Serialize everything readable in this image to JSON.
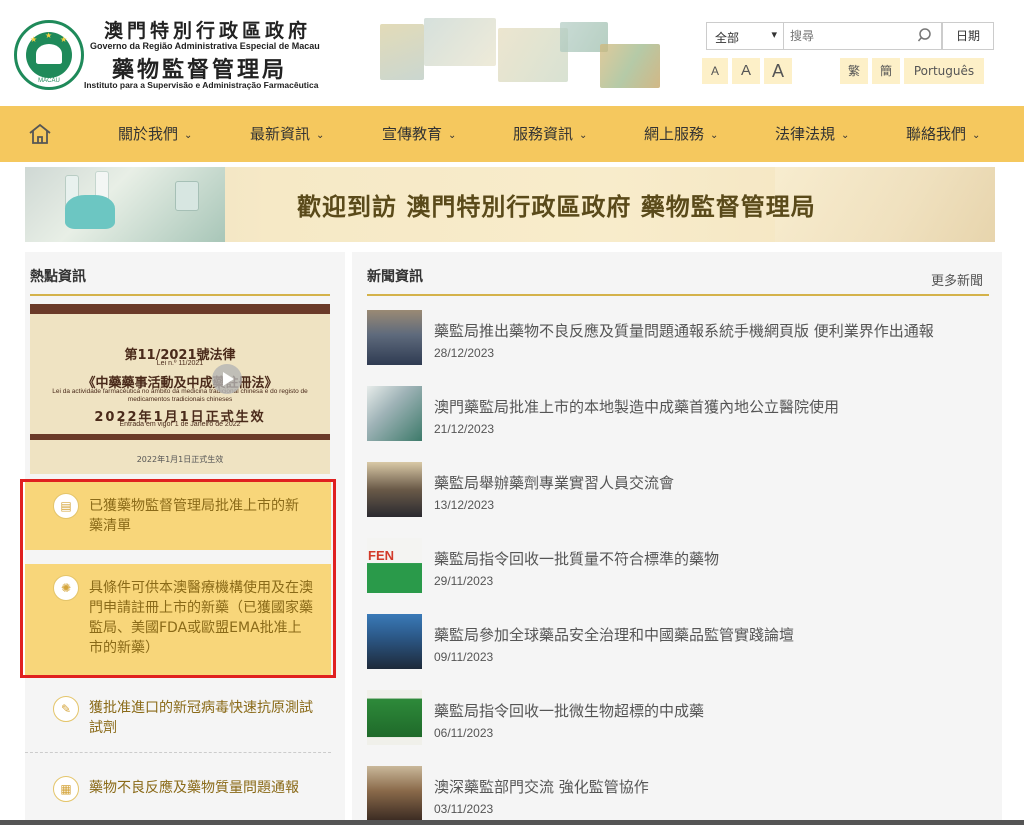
{
  "header": {
    "gov_cn": "澳門特別行政區政府",
    "gov_pt": "Governo da Região Administrativa Especial de Macau",
    "inst_cn": "藥物監督管理局",
    "inst_pt": "Instituto para a Supervisão e Administração Farmacêutica",
    "emblem_text": "MACAU",
    "search": {
      "scope": "全部",
      "placeholder": "搜尋",
      "date_label": "日期"
    },
    "font_sizes": [
      "A",
      "A",
      "A"
    ],
    "languages": [
      "繁",
      "簡",
      "Português"
    ]
  },
  "nav": {
    "items": [
      "關於我們",
      "最新資訊",
      "宣傳教育",
      "服務資訊",
      "網上服務",
      "法律法規",
      "聯絡我們"
    ]
  },
  "banner": {
    "title": "歡迎到訪 澳門特別行政區政府 藥物監督管理局"
  },
  "hot": {
    "title": "熱點資訊",
    "promo": {
      "line1": "第11/2021號法律",
      "line2": "Lei n.º 11/2021",
      "line3": "《中藥藥事活動及中成藥註冊法》",
      "line4": "Lei da actividade farmacêutica no âmbito da medicina tradicional chinesa e do registo de medicamentos tradicionais chineses",
      "line5": "2022年1月1日正式生效",
      "line6": "Entrada em vigor 1 de Janeiro de 2022",
      "line7": "2022年1月1日正式生效"
    },
    "items": [
      {
        "text": "已獲藥物監督管理局批准上市的新藥清單"
      },
      {
        "text": "具條件可供本澳醫療機構使用及在澳門申請註冊上市的新藥（已獲國家藥監局、美國FDA或歐盟EMA批准上市的新藥）"
      },
      {
        "text": "獲批准進口的新冠病毒快速抗原測試試劑"
      },
      {
        "text": "藥物不良反應及藥物質量問題通報"
      }
    ]
  },
  "news": {
    "title": "新聞資訊",
    "more": "更多新聞",
    "items": [
      {
        "title": "藥監局推出藥物不良反應及質量問題通報系統手機網頁版 便利業界作出通報",
        "date": "28/12/2023"
      },
      {
        "title": "澳門藥監局批准上市的本地製造中成藥首獲內地公立醫院使用",
        "date": "21/12/2023"
      },
      {
        "title": "藥監局舉辦藥劑專業實習人員交流會",
        "date": "13/12/2023"
      },
      {
        "title": "藥監局指令回收一批質量不符合標準的藥物",
        "date": "29/11/2023"
      },
      {
        "title": "藥監局參加全球藥品安全治理和中國藥品監管實踐論壇",
        "date": "09/11/2023"
      },
      {
        "title": "藥監局指令回收一批微生物超標的中成藥",
        "date": "06/11/2023"
      },
      {
        "title": "澳深藥監部門交流 強化監管協作",
        "date": "03/11/2023"
      }
    ],
    "thumb_texts": {
      "fen": "FEN"
    }
  },
  "colors": {
    "accent": "#f5c85e",
    "card": "#f8d67a",
    "rule": "#d4b24a",
    "highlight_frame": "#e02020"
  }
}
